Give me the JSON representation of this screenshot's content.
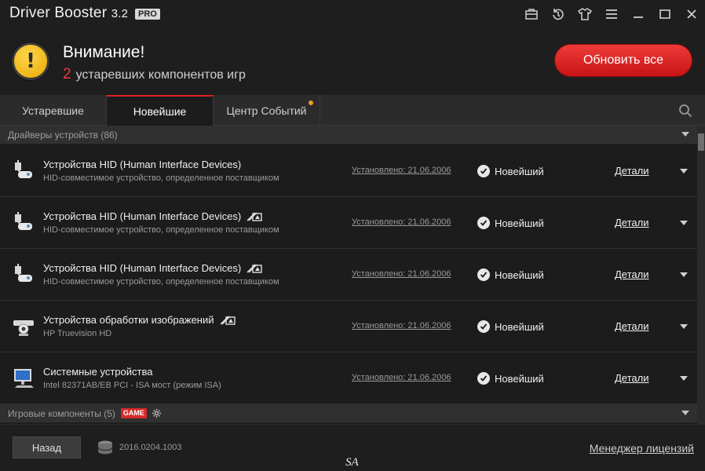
{
  "app": {
    "title": "Driver Booster",
    "version": "3.2",
    "badge": "PRO"
  },
  "titlebar_icons": [
    "toolbox-icon",
    "restore-icon",
    "shirt-icon",
    "menu-icon",
    "minimize-icon",
    "maximize-icon",
    "close-icon"
  ],
  "header": {
    "title": "Внимание!",
    "count": "2",
    "subtitle": "устаревших компонентов игр",
    "update_button": "Обновить все",
    "accent": "#e02020"
  },
  "tabs": [
    {
      "label": "Устаревшие",
      "active": false
    },
    {
      "label": "Новейшие",
      "active": true
    },
    {
      "label": "Центр Событий",
      "active": false,
      "has_notification": true
    }
  ],
  "sections": {
    "drivers": "Драйверы устройств (86)",
    "games": "Игровые компоненты (5)",
    "game_badge": "GAME"
  },
  "drivers": [
    {
      "name": "Устройства HID (Human Interface Devices)",
      "desc": "HID-совместимое устройство, определенное поставщиком",
      "installed": "Установлено: 21.06.2006",
      "status": "Новейший",
      "details": "Детали",
      "icon": "hid-device-icon",
      "no_sign": false
    },
    {
      "name": "Устройства HID (Human Interface Devices)",
      "desc": "HID-совместимое устройство, определенное поставщиком",
      "installed": "Установлено: 21.06.2006",
      "status": "Новейший",
      "details": "Детали",
      "icon": "hid-device-icon",
      "no_sign": true
    },
    {
      "name": "Устройства HID (Human Interface Devices)",
      "desc": "HID-совместимое устройство, определенное поставщиком",
      "installed": "Установлено: 21.06.2006",
      "status": "Новейший",
      "details": "Детали",
      "icon": "hid-device-icon",
      "no_sign": true
    },
    {
      "name": "Устройства обработки изображений",
      "desc": "HP Truevision HD",
      "installed": "Установлено: 21.06.2006",
      "status": "Новейший",
      "details": "Детали",
      "icon": "camera-icon",
      "no_sign": true
    },
    {
      "name": "Системные устройства",
      "desc": "Intel 82371AB/EB PCI - ISA мост (режим ISA)",
      "installed": "Установлено: 21.06.2006",
      "status": "Новейший",
      "details": "Детали",
      "icon": "computer-icon",
      "no_sign": false
    }
  ],
  "footer": {
    "back_button": "Назад",
    "version": "2016.0204.1003",
    "license_link": "Менеджер лицензий",
    "watermark": "SA"
  }
}
